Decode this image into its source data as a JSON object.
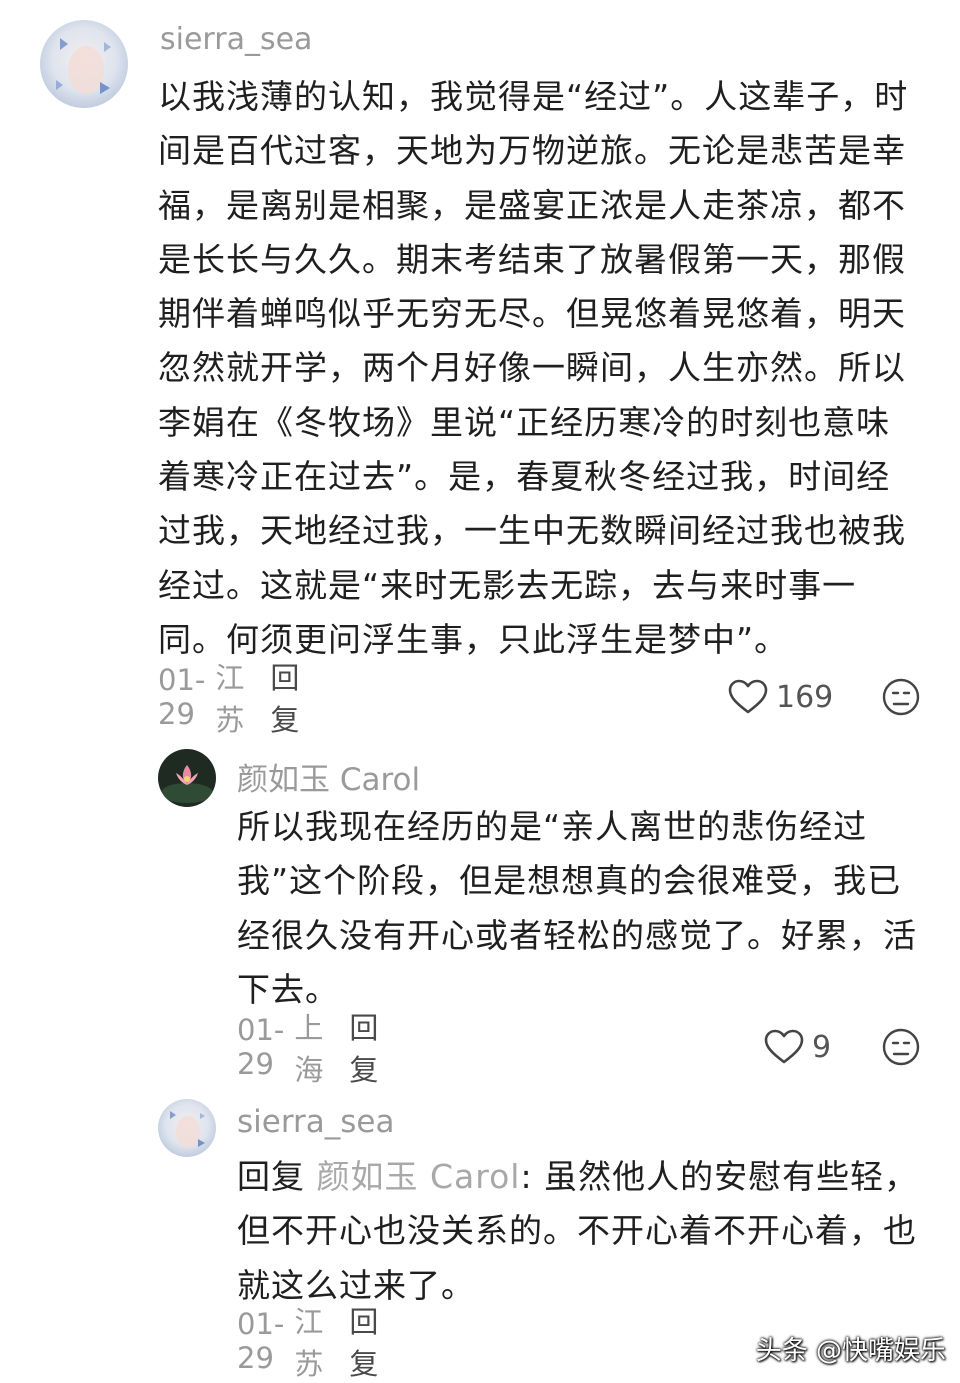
{
  "comments": [
    {
      "username": "sierra_sea",
      "avatar_icon": "butterfly-avatar-icon",
      "text": "以我浅薄的认知，我觉得是“经过”。人这辈子，时间是百代过客，天地为万物逆旅。无论是悲苦是幸福，是离别是相聚，是盛宴正浓是人走茶凉，都不是长长与久久。期末考结束了放暑假第一天，那假期伴着蝉鸣似乎无穷无尽。但晃悠着晃悠着，明天忽然就开学，两个月好像一瞬间，人生亦然。所以李娟在《冬牧场》里说“正经历寒冷的时刻也意味着寒冷正在过去”。是，春夏秋冬经过我，时间经过我，天地经过我，一生中无数瞬间经过我也被我经过。这就是“来时无影去无踪，去与来时事一同。何须更问浮生事，只此浮生是梦中”。",
      "date": "01-29",
      "location": "江苏",
      "reply_label": "回复",
      "likes": "169"
    },
    {
      "username": "颜如玉 Carol",
      "avatar_icon": "lotus-avatar-icon",
      "text": "所以我现在经历的是“亲人离世的悲伤经过我”这个阶段，但是想想真的会很难受，我已经很久没有开心或者轻松的感觉了。好累，活下去。",
      "date": "01-29",
      "location": "上海",
      "reply_label": "回复",
      "likes": "9"
    },
    {
      "username": "sierra_sea",
      "avatar_icon": "butterfly-avatar-icon",
      "reply_prefix": "回复",
      "reply_target": "颜如玉 Carol",
      "text": ": 虽然他人的安慰有些轻，但不开心也没关系的。不开心着不开心着，也就这么过来了。",
      "date": "01-29",
      "location": "江苏",
      "reply_label": "回复"
    }
  ],
  "watermark": {
    "text": "头条 @快嘴娱乐"
  },
  "colors": {
    "meta_gray": "#9a9a9a",
    "text": "#1f1f1f",
    "reply_target": "#a8a8a8"
  }
}
